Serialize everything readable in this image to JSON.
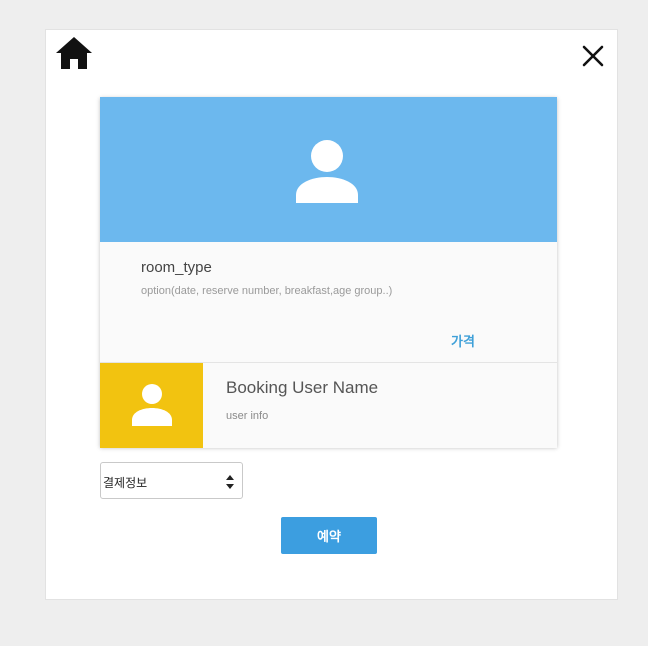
{
  "header": {
    "home_icon": "home-icon",
    "close_icon": "close-icon"
  },
  "room": {
    "type": "room_type",
    "option": "option(date, reserve number, breakfast,age group..)",
    "price_label": "가격",
    "hero_color": "#6cb8ee"
  },
  "user": {
    "name": "Booking User Name",
    "info": "user info",
    "avatar_bg": "#f2c310"
  },
  "payment": {
    "selected": "결제정보"
  },
  "actions": {
    "reserve_label": "예약",
    "accent": "#3c9ee0"
  }
}
